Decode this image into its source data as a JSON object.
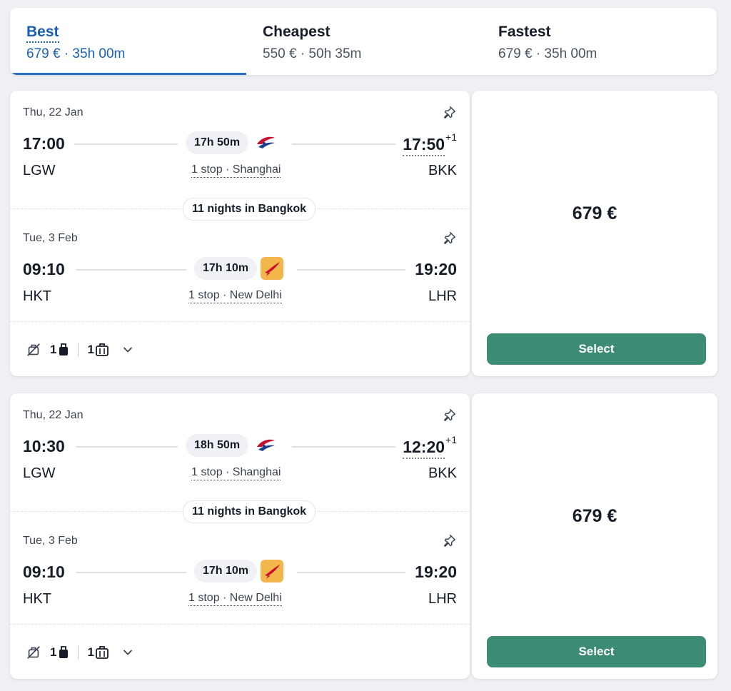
{
  "sort_tabs": [
    {
      "title": "Best",
      "subtitle": "679 € · 35h 00m",
      "active": true
    },
    {
      "title": "Cheapest",
      "subtitle": "550 € · 50h 35m",
      "active": false
    },
    {
      "title": "Fastest",
      "subtitle": "679 € · 35h 00m",
      "active": false
    }
  ],
  "results": [
    {
      "outbound": {
        "date": "Thu, 22 Jan",
        "dep_time": "17:00",
        "arr_time": "17:50",
        "day_offset": "+1",
        "duration": "17h 50m",
        "from": "LGW",
        "to": "BKK",
        "stops": "1 stop · Shanghai",
        "airline_icon": "china-eastern-logo"
      },
      "stay": "11 nights in Bangkok",
      "inbound": {
        "date": "Tue, 3 Feb",
        "dep_time": "09:10",
        "arr_time": "19:20",
        "day_offset": "",
        "duration": "17h 10m",
        "from": "HKT",
        "to": "LHR",
        "stops": "1 stop · New Delhi",
        "airline_icon": "air-india-logo"
      },
      "amenities": {
        "personal_item": "1",
        "carry_on": "1"
      },
      "price": "679 €",
      "select_label": "Select"
    },
    {
      "outbound": {
        "date": "Thu, 22 Jan",
        "dep_time": "10:30",
        "arr_time": "12:20",
        "day_offset": "+1",
        "duration": "18h 50m",
        "from": "LGW",
        "to": "BKK",
        "stops": "1 stop · Shanghai",
        "airline_icon": "china-eastern-logo"
      },
      "stay": "11 nights in Bangkok",
      "inbound": {
        "date": "Tue, 3 Feb",
        "dep_time": "09:10",
        "arr_time": "19:20",
        "day_offset": "",
        "duration": "17h 10m",
        "from": "HKT",
        "to": "LHR",
        "stops": "1 stop · New Delhi",
        "airline_icon": "air-india-logo"
      },
      "amenities": {
        "personal_item": "1",
        "carry_on": "1"
      },
      "price": "679 €",
      "select_label": "Select"
    }
  ],
  "colors": {
    "accent": "#1b5fb4",
    "select_button": "#3c8c75",
    "background": "#eef0f3"
  }
}
